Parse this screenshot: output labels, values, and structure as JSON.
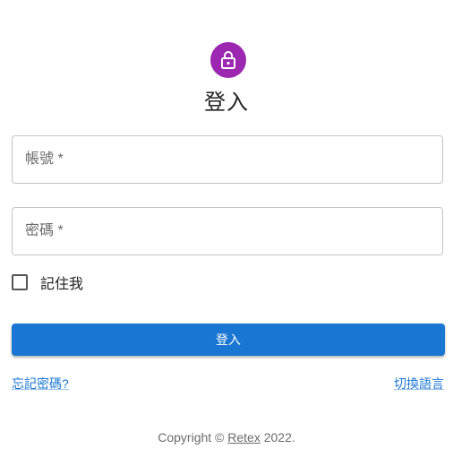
{
  "header": {
    "title": "登入",
    "avatar_icon": "lock-icon",
    "avatar_color": "#9c27b0"
  },
  "form": {
    "username_placeholder": "帳號 *",
    "password_placeholder": "密碼 *",
    "username_value": "",
    "password_value": "",
    "remember_label": "記住我",
    "remember_checked": false,
    "submit_label": "登入",
    "submit_color": "#1976d2"
  },
  "links": {
    "forgot_password": "忘記密碼?",
    "switch_language": "切換語言"
  },
  "footer": {
    "prefix": "Copyright © ",
    "company": "Retex",
    "suffix": " 2022."
  }
}
